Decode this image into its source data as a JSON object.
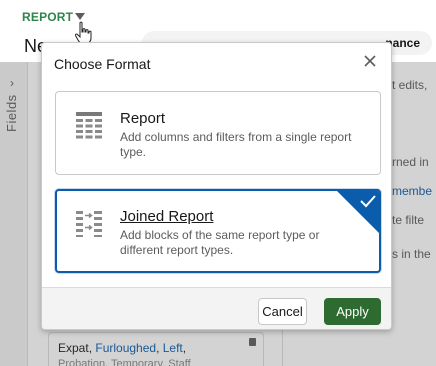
{
  "header": {
    "report_label": "REPORT",
    "page_title_fragment": "Ne",
    "pill_text": "nance"
  },
  "fields_rail": {
    "label": "Fields"
  },
  "right_panel": {
    "lines": [
      {
        "text": "t edits,",
        "link": false
      },
      {
        "text": "rned in",
        "link": false
      },
      {
        "text": "membe",
        "link": true
      },
      {
        "text": "te filte",
        "link": false
      },
      {
        "text": "s in the",
        "link": false
      }
    ]
  },
  "filter_card": {
    "values": [
      "Expat",
      "Furloughed",
      "Left"
    ],
    "separator": ", ",
    "trailing": ",",
    "second_line": "Probation, Temporary, Staff"
  },
  "modal": {
    "title": "Choose Format",
    "close_icon": "close-icon",
    "options": [
      {
        "title": "Report",
        "description": "Add columns and filters from a single report type.",
        "icon": "table-icon",
        "selected": false
      },
      {
        "title": "Joined Report",
        "description": "Add blocks of the same report type or different report types.",
        "icon": "joined-report-icon",
        "selected": true
      }
    ],
    "cancel_label": "Cancel",
    "apply_label": "Apply"
  },
  "colors": {
    "brand_green": "#2e844a",
    "apply_green": "#2e6b30",
    "selected_blue": "#0b5cab",
    "link_blue": "#0b5cab"
  }
}
